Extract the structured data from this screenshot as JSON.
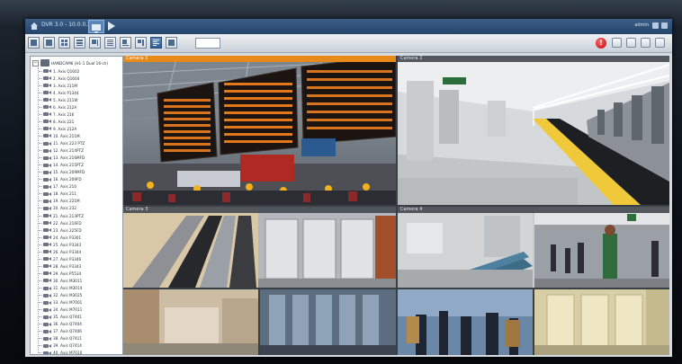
{
  "window": {
    "title": "DVR 3.0 - 10.0.0.237",
    "user": "admin"
  },
  "icons": {
    "home": "home-icon",
    "live": "monitor-icon",
    "playback": "play-icon",
    "alarm": "alarm-icon"
  },
  "alarm": {
    "glyph": "!"
  },
  "tree": {
    "root": "HANDCAM6 (H1-1 Dual 16-ch)",
    "items": [
      "1. Axis Q1602",
      "2. Axis Q1604",
      "3. Axis 211M",
      "4. Axis P1344",
      "5. Axis 211W",
      "6. Axis 212A",
      "7. Axis 216",
      "8. Axis 221",
      "9. Axis 212A",
      "10. Axis 211M",
      "11. Axis 223 PTZ",
      "12. Axis 214PTZ",
      "13. Axis 216MFD",
      "14. Axis 215PTZ",
      "15. Axis 209MFD",
      "16. Axis 209FD",
      "17. Axis 210",
      "18. Axis 211",
      "19. Axis 221M",
      "20. Axis 232",
      "21. Axis 213PTZ",
      "22. Axis 216FD",
      "23. Axis 225FD",
      "24. Axis P3301",
      "25. Axis P3343",
      "26. Axis P3344",
      "27. Axis P3346",
      "28. Axis P3343",
      "29. Axis P5534",
      "30. Axis M3011",
      "31. Axis M3014",
      "32. Axis M3025",
      "33. Axis M7001",
      "34. Axis M7011",
      "35. Axis Q7401",
      "36. Axis Q7404",
      "37. Axis Q7406",
      "38. Axis Q7411",
      "39. Axis Q7414",
      "40. Axis M7010"
    ]
  },
  "cameras": [
    {
      "label": "Camera 1"
    },
    {
      "label": "Camera 2"
    },
    {
      "label": "Camera 3"
    },
    {
      "label": "Camera 4"
    }
  ],
  "colors": {
    "selected_tile": "#e88a1a",
    "titlebar": "#2d4f78",
    "alarm": "#d6000d"
  }
}
